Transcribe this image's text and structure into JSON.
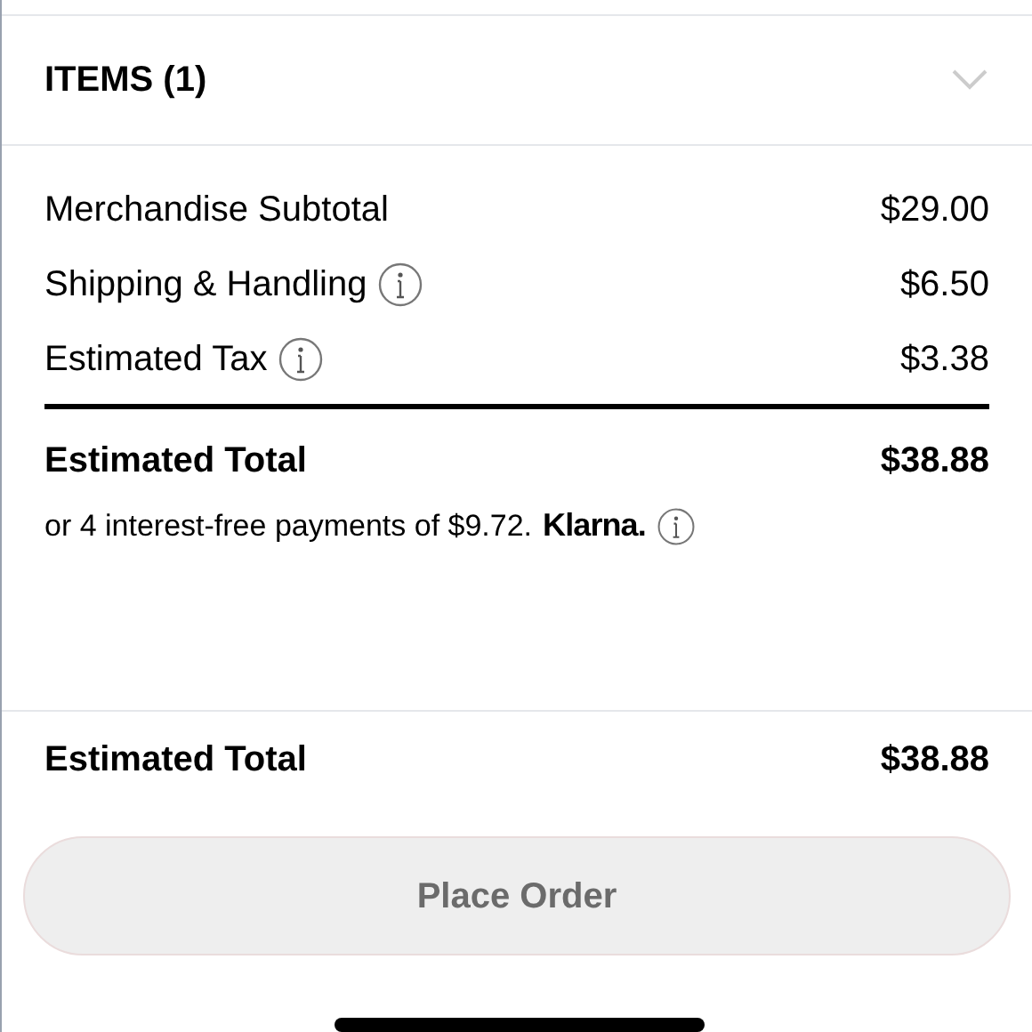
{
  "items_section": {
    "title": "ITEMS (1)",
    "expanded": false
  },
  "summary_lines": [
    {
      "label": "Merchandise Subtotal",
      "value": "$29.00",
      "info": false
    },
    {
      "label": "Shipping & Handling",
      "value": "$6.50",
      "info": true
    },
    {
      "label": "Estimated Tax",
      "value": "$3.38",
      "info": true
    }
  ],
  "total": {
    "label": "Estimated Total",
    "value": "$38.88"
  },
  "installments": {
    "text": "or 4 interest-free payments of $9.72.",
    "provider": "Klarna."
  },
  "footer": {
    "total_label": "Estimated Total",
    "total_value": "$38.88",
    "button": {
      "label": "Place Order",
      "disabled": true
    }
  }
}
